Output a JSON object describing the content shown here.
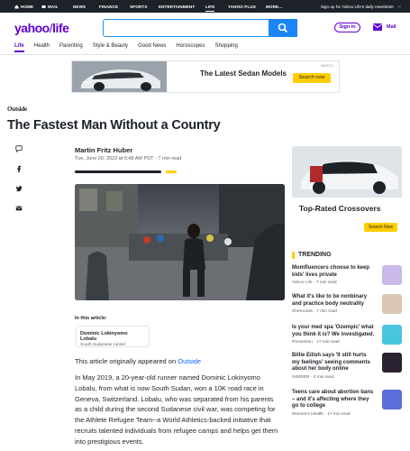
{
  "topnav": {
    "items": [
      {
        "label": "HOME",
        "icon": "home-icon"
      },
      {
        "label": "MAIL",
        "icon": "mail-icon"
      },
      {
        "label": "NEWS"
      },
      {
        "label": "FINANCE"
      },
      {
        "label": "SPORTS"
      },
      {
        "label": "ENTERTAINMENT"
      },
      {
        "label": "LIFE",
        "active": true
      },
      {
        "label": "YAHOO PLUS"
      },
      {
        "label": "MORE..."
      }
    ],
    "signup": "Sign up for Yahoo Life's daily newsletter"
  },
  "header": {
    "logo_main": "yahoo",
    "logo_slash": "/",
    "logo_section": "life",
    "search_placeholder": "",
    "signin": "Sign in",
    "mail": "Mail"
  },
  "subnav": [
    "Life",
    "Health",
    "Parenting",
    "Style & Beauty",
    "Good News",
    "Horoscopes",
    "Shopping"
  ],
  "ad_banner": {
    "title": "The Latest Sedan Models",
    "button": "Search now",
    "brand": "SUCCY"
  },
  "article": {
    "source": "Outside",
    "headline": "The Fastest Man Without a Country",
    "author": "Martin Fritz Huber",
    "date": "Tue, June 20, 2023 at 6:48 AM PDT",
    "read_time": "7 min read",
    "in_article_label": "In this article:",
    "entity_name": "Dominic Lokinyomo Lobalu",
    "entity_desc": "South Sudanese runner",
    "orig_prefix": "This article originally appeared on ",
    "orig_link": "Outside",
    "body": "In May 2019, a 20-year-old runner named Dominic Lokinyomo Lobalu, from what is now South Sudan, won a 10K road race in Geneva, Switzerland. Lobalu, who was separated from his parents as a child during the second Sudanese civil war, was competing for the Athlete Refugee Team--a World Athletics-backed initiative that recruits talented individuals from refugee camps and helps get them into prestigious events."
  },
  "side_ad": {
    "title": "Top-Rated Crossovers",
    "button": "Search Now"
  },
  "trending": {
    "label": "TRENDING",
    "items": [
      {
        "title": "Momfluencers choose to keep kids' lives private",
        "source": "Yahoo Life",
        "read": "7 min read",
        "thumb": "#c9b8e8"
      },
      {
        "title": "What it's like to be nonbinary and practice body neutrality",
        "source": "SheKnows",
        "read": "7 min read",
        "thumb": "#d9c5b2"
      },
      {
        "title": "Is your med spa 'Ozempic' what you think it is? We investigated.",
        "source": "Prevention",
        "read": "17 min read",
        "thumb": "#48c6e0"
      },
      {
        "title": "Billie Eilish says 'It still hurts my feelings' seeing comments about her body online",
        "source": "INSIDER",
        "read": "2 min read",
        "thumb": "#2a2230"
      },
      {
        "title": "Teens care about abortion bans – and it's affecting where they go to college",
        "source": "Women's Health",
        "read": "17 min read",
        "thumb": "#5a6dd8"
      }
    ]
  },
  "colors": {
    "brand": "#6001d2",
    "search_blue": "#1b84f6",
    "accent_yellow": "#ffcd00",
    "link": "#0f69ff"
  }
}
